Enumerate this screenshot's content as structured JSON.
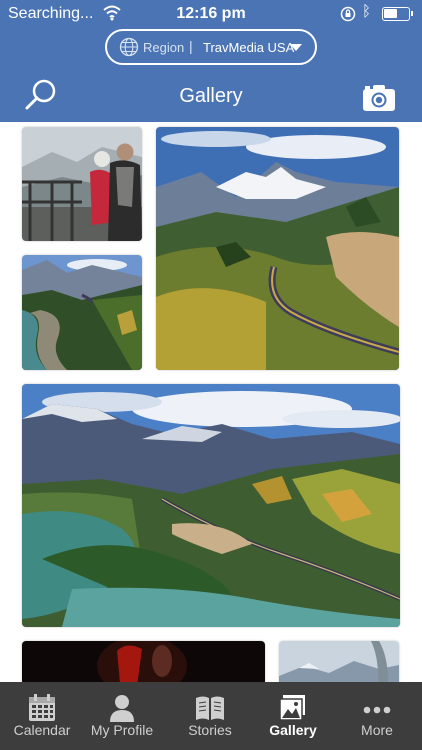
{
  "status_bar": {
    "carrier": "Searching...",
    "time": "12:16 pm"
  },
  "header": {
    "region_label": "Region",
    "region_separator": "|",
    "region_value": "TravMedia USA",
    "title": "Gallery"
  },
  "gallery": {
    "photos": [
      {
        "icon": "couple-at-railing-photo"
      },
      {
        "icon": "mountain-train-photo"
      },
      {
        "icon": "river-canyon-train-photo"
      },
      {
        "icon": "lake-valley-train-photo"
      },
      {
        "icon": "dark-interior-photo"
      },
      {
        "icon": "mountain-window-photo"
      }
    ]
  },
  "tabbar": {
    "tabs": [
      {
        "label": "Calendar",
        "icon": "calendar-icon"
      },
      {
        "label": "My Profile",
        "icon": "profile-icon"
      },
      {
        "label": "Stories",
        "icon": "book-icon"
      },
      {
        "label": "Gallery",
        "icon": "gallery-icon",
        "active": true
      },
      {
        "label": "More",
        "icon": "more-icon"
      }
    ]
  },
  "colors": {
    "header_bg": "#4a74b4",
    "tabbar_bg": "#3d3d3d",
    "active_tab": "#ffffff",
    "inactive_tab": "#cfcfcf"
  }
}
